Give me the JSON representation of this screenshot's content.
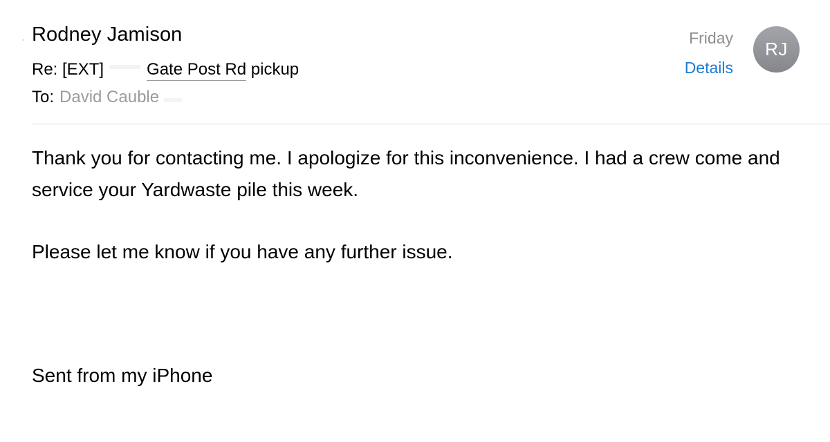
{
  "message": {
    "sender_name": "Rodney Jamison",
    "date": "Friday",
    "details_label": "Details",
    "avatar_initials": "RJ",
    "subject_prefix": "Re: [EXT]",
    "subject_text": "Gate Post Rd",
    "subject_suffix": " pickup",
    "to_label": "To:",
    "to_recipient": "David Cauble",
    "body_paragraphs": [
      "Thank you for contacting me. I apologize for this inconvenience. I had a crew come and service your Yardwaste pile this week.",
      "Please let me know if you have any further issue."
    ],
    "signature": "Sent from my iPhone"
  },
  "colors": {
    "link": "#1e7ad6",
    "muted": "#8e8e93",
    "avatar_bg": "#96979c",
    "divider": "#d9d9d9"
  }
}
